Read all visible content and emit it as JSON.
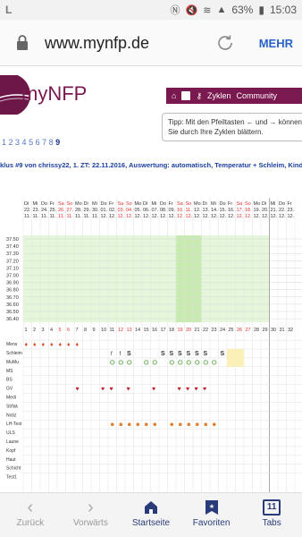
{
  "status": {
    "carrier_icon": "L",
    "battery": "63%",
    "time": "15:03"
  },
  "browser": {
    "url": "www.mynfp.de",
    "more_label": "MEHR"
  },
  "site": {
    "logo_text": "myNFP",
    "nav": {
      "cycles": "Zyklen",
      "community": "Community"
    },
    "tip": "Tipp: Mit den Pfeiltasten ← und → können Sie durch Ihre Zyklen blättern.",
    "pages": [
      "1",
      "2",
      "3",
      "4",
      "5",
      "6",
      "7",
      "8"
    ],
    "current_page": "9",
    "cycle_title": "klus #9 von chrissy22, 1. ZT: 22.11.2016, Auswertung: automatisch, Temperatur + Schleim, Kinde"
  },
  "chart_data": {
    "type": "table",
    "days": [
      {
        "wd": "Di",
        "d": "22.",
        "m": "11."
      },
      {
        "wd": "Mi",
        "d": "23.",
        "m": "11."
      },
      {
        "wd": "Do",
        "d": "24.",
        "m": "11."
      },
      {
        "wd": "Fr",
        "d": "25.",
        "m": "11."
      },
      {
        "wd": "Sa",
        "d": "26.",
        "m": "11.",
        "we": true
      },
      {
        "wd": "So",
        "d": "27.",
        "m": "11.",
        "we": true
      },
      {
        "wd": "Mo",
        "d": "28.",
        "m": "11."
      },
      {
        "wd": "Di",
        "d": "29.",
        "m": "11."
      },
      {
        "wd": "Mi",
        "d": "30.",
        "m": "11."
      },
      {
        "wd": "Do",
        "d": "01.",
        "m": "12."
      },
      {
        "wd": "Fr",
        "d": "02.",
        "m": "12."
      },
      {
        "wd": "Sa",
        "d": "03.",
        "m": "12.",
        "we": true
      },
      {
        "wd": "So",
        "d": "04.",
        "m": "12.",
        "we": true
      },
      {
        "wd": "Mo",
        "d": "05.",
        "m": "12."
      },
      {
        "wd": "Di",
        "d": "06.",
        "m": "12."
      },
      {
        "wd": "Mi",
        "d": "07.",
        "m": "12."
      },
      {
        "wd": "Do",
        "d": "08.",
        "m": "12."
      },
      {
        "wd": "Fr",
        "d": "09.",
        "m": "12."
      },
      {
        "wd": "Sa",
        "d": "10.",
        "m": "12.",
        "we": true
      },
      {
        "wd": "So",
        "d": "11.",
        "m": "12.",
        "we": true
      },
      {
        "wd": "Mo",
        "d": "12.",
        "m": "12."
      },
      {
        "wd": "Di",
        "d": "13.",
        "m": "12."
      },
      {
        "wd": "Mi",
        "d": "14.",
        "m": "12."
      },
      {
        "wd": "Do",
        "d": "15.",
        "m": "12."
      },
      {
        "wd": "Fr",
        "d": "16.",
        "m": "12."
      },
      {
        "wd": "Sa",
        "d": "17.",
        "m": "12.",
        "we": true
      },
      {
        "wd": "So",
        "d": "18.",
        "m": "12.",
        "we": true
      },
      {
        "wd": "Mo",
        "d": "19.",
        "m": "12."
      },
      {
        "wd": "Di",
        "d": "20.",
        "m": "12."
      },
      {
        "wd": "Mi",
        "d": "21.",
        "m": "12."
      },
      {
        "wd": "Do",
        "d": "22.",
        "m": "12."
      },
      {
        "wd": "Fr",
        "d": "23.",
        "m": "12."
      }
    ],
    "temp_ticks": [
      "37.50",
      "37.40",
      "37.30",
      "37.20",
      "37.10",
      "37.00",
      "36.90",
      "36.80",
      "36.70",
      "36.60",
      "36.50",
      "36.40"
    ],
    "day_numbers": [
      "1",
      "2",
      "3",
      "4",
      "5",
      "6",
      "7",
      "8",
      "9",
      "10",
      "11",
      "12",
      "13",
      "14",
      "15",
      "16",
      "17",
      "18",
      "19",
      "20",
      "21",
      "22",
      "23",
      "24",
      "25",
      "26",
      "27",
      "28",
      "29",
      "30",
      "31",
      "32"
    ],
    "cycle_days_shaded": 29,
    "fertile_days": [
      19,
      20,
      21
    ],
    "row_labels": [
      "Mens",
      "Schleim",
      "MuMu",
      "MS",
      "BS",
      "GV",
      "Medi",
      "Strfak",
      "Notiz",
      "LH-Test",
      "ULS",
      "Laune",
      "Kopf",
      "Haut",
      "Schicht",
      "Test1"
    ],
    "mens": [
      1,
      2,
      3,
      4,
      5,
      6,
      7
    ],
    "schleim": {
      "f": [
        11,
        12
      ],
      "S": [
        13,
        17,
        18,
        19,
        20,
        21,
        22,
        24,
        25,
        26
      ],
      "Sp": [
        20,
        22,
        23,
        25
      ]
    },
    "colors": {
      "accent": "#7a1850",
      "fertile_shade": "#c8ebb0",
      "cycle_shade": "#e6f6da",
      "weekend": "#e03030",
      "link": "#1b3fa0"
    }
  },
  "bottomnav": {
    "back": "Zurück",
    "forward": "Vorwärts",
    "home": "Startseite",
    "favorites": "Favoriten",
    "tabs": "Tabs",
    "tab_count": "11"
  }
}
